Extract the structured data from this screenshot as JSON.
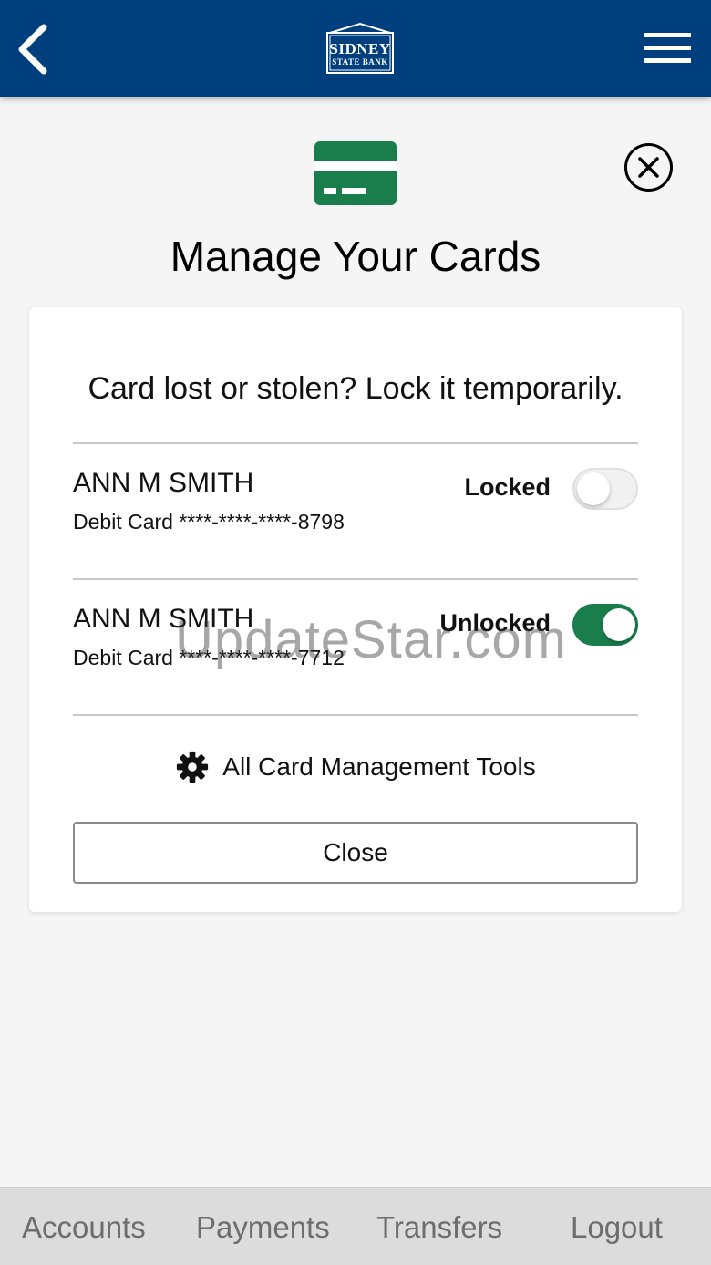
{
  "header": {
    "logo_line1": "SIDNEY",
    "logo_line2": "STATE BANK",
    "back_icon": "chevron-left-icon",
    "menu_icon": "hamburger-menu-icon"
  },
  "colors": {
    "header_bg": "#003f7d",
    "accent_green": "#1a7d4c",
    "page_bg": "#f5f5f5"
  },
  "main": {
    "title": "Manage Your Cards",
    "prompt": "Card lost or stolen? Lock it temporarily.",
    "cards": [
      {
        "holder": "ANN M SMITH",
        "description": "Debit Card ****-****-****-8798",
        "status": "Locked",
        "toggle_on": false
      },
      {
        "holder": "ANN M SMITH",
        "description": "Debit Card ****-****-****-7712",
        "status": "Unlocked",
        "toggle_on": true
      }
    ],
    "tools_label": "All Card Management Tools",
    "close_label": "Close"
  },
  "watermark": "UpdateStar.com",
  "bottom_nav": {
    "items": [
      "Accounts",
      "Payments",
      "Transfers",
      "Logout"
    ]
  }
}
